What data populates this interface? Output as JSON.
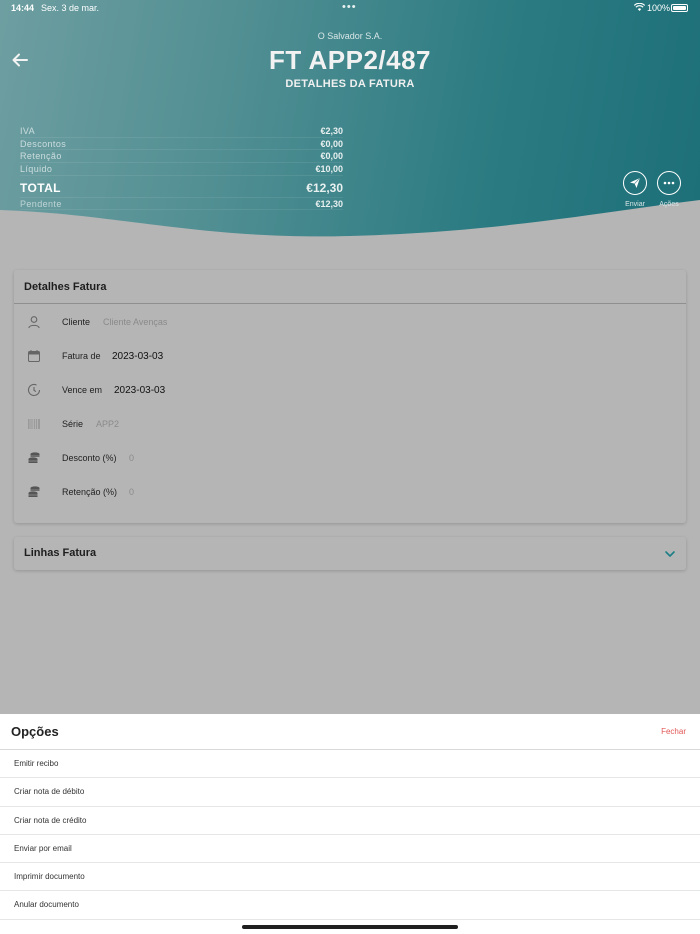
{
  "status_bar": {
    "time": "14:44",
    "date": "Sex. 3 de mar.",
    "battery": "100%"
  },
  "header": {
    "company": "O Salvador S.A.",
    "title": "FT APP2/487",
    "subtitle": "DETALHES DA FATURA",
    "totals": [
      {
        "label": "IVA",
        "value": "€2,30"
      },
      {
        "label": "Descontos",
        "value": "€0,00"
      },
      {
        "label": "Retenção",
        "value": "€0,00"
      },
      {
        "label": "Líquido",
        "value": "€10,00"
      }
    ],
    "total": {
      "label": "TOTAL",
      "value": "€12,30"
    },
    "pending": {
      "label": "Pendente",
      "value": "€12,30"
    },
    "actions": {
      "send_label": "Enviar",
      "more_label": "Ações"
    }
  },
  "details_card": {
    "title": "Detalhes Fatura",
    "fields": [
      {
        "label": "Cliente",
        "value": "Cliente Avenças",
        "icon": "person-icon"
      },
      {
        "label": "Fatura de",
        "value": "2023-03-03",
        "icon": "calendar-icon"
      },
      {
        "label": "Vence em",
        "value": "2023-03-03",
        "icon": "clock-icon"
      },
      {
        "label": "Série",
        "value": "APP2",
        "icon": "barcode-icon"
      },
      {
        "label": "Desconto (%)",
        "value": "0",
        "icon": "coins-icon"
      },
      {
        "label": "Retenção (%)",
        "value": "0",
        "icon": "coins-icon"
      }
    ]
  },
  "lines_card": {
    "title": "Linhas Fatura"
  },
  "sheet": {
    "title": "Opções",
    "close_label": "Fechar",
    "options": [
      "Emitir recibo",
      "Criar nota de débito",
      "Criar nota de crédito",
      "Enviar por email",
      "Imprimir documento",
      "Anular documento"
    ]
  },
  "colors": {
    "teal_dark": "#1d6f78",
    "teal_light": "#6e9ea1",
    "close_red": "#e35656",
    "overlay_gray": "#b5b5b5"
  }
}
